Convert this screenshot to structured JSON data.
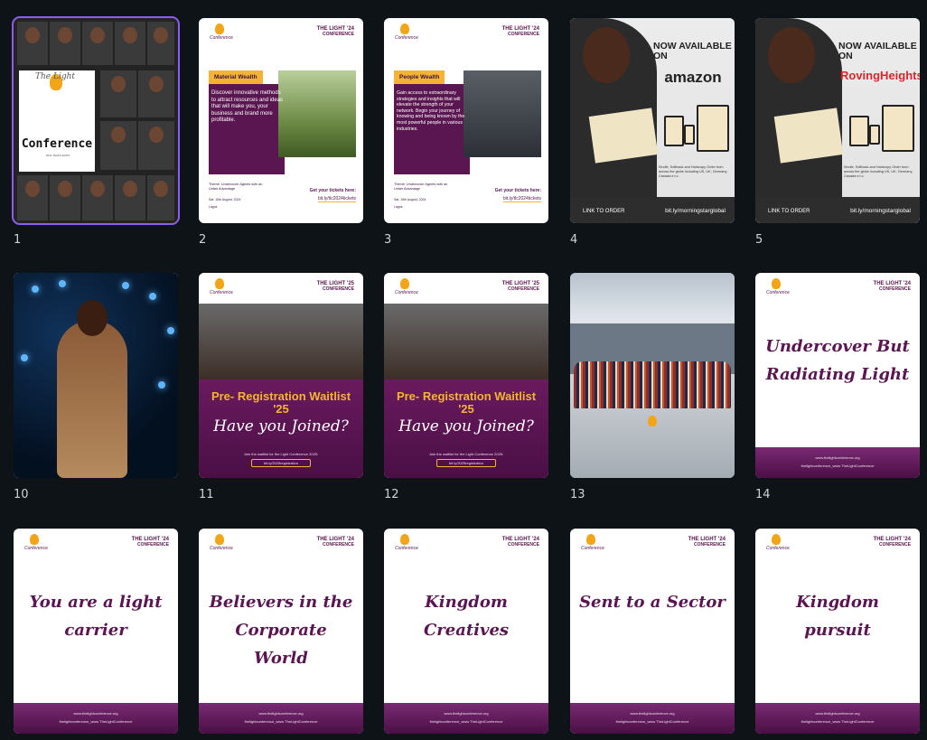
{
  "grid": {
    "selected_index": 0,
    "items": [
      {
        "number": "1",
        "kind": "collage",
        "title": "Conference",
        "pre": "The Light",
        "sub": "2024 TEAM LEADS"
      },
      {
        "number": "2",
        "kind": "wealth",
        "label": "Material Wealth",
        "body": "Discover innovative methods to attract resources and ideas that will make you, your business and brand more profitable.",
        "theme": "Theme: Undercover Agents with an Unfair Advantage",
        "date": "Sat. 10th August, 2024",
        "place": "Lagos",
        "get": "Get your tickets here:",
        "link": "bit.ly/tlc2024tickets"
      },
      {
        "number": "3",
        "kind": "wealth",
        "label": "People Wealth",
        "body": "Gain access to extraordinary strategies and insights that will elevate the strength of your network. Begin your journey of knowing and being known by the most powerful people in various industries.",
        "theme": "Theme: Undercover Agents with an Unfair Advantage",
        "date": "Sat. 10th August, 2024",
        "place": "Lagos",
        "get": "Get your tickets here:",
        "link": "bit.ly/tlc2024tickets"
      },
      {
        "number": "4",
        "kind": "book",
        "now": "NOW AVAILABLE ON",
        "store": "amazon",
        "store_color": "#222222",
        "desc": "Kindle, Softback and Hardcopy Order from across the globe including US, UK, Germany, Canada e.t.c.",
        "order": "LINK TO ORDER",
        "url": "bit.ly/morningstarglobal"
      },
      {
        "number": "5",
        "kind": "book",
        "now": "NOW AVAILABLE ON",
        "store": "RovingHeights",
        "store_color": "#d9262b",
        "desc": "Kindle, Softback and Hardcopy Order from across the globe including US, UK, Germany, Canada e.t.c.",
        "order": "LINK TO ORDER",
        "url": "bit.ly/morningstarglobal"
      },
      {
        "number": "10",
        "kind": "stage"
      },
      {
        "number": "11",
        "kind": "prereg",
        "brand": "THE LIGHT '25",
        "headline": "Pre- Registration Waitlist '25",
        "script": "Have you Joined?",
        "join": "Join the waitlist for the Light Conference 2025:",
        "link": "bit.ly/2025registration"
      },
      {
        "number": "12",
        "kind": "prereg",
        "brand": "THE LIGHT '25",
        "headline": "Pre- Registration Waitlist '25",
        "script": "Have you Joined?",
        "join": "Join the waitlist for the Light Conference 2025:",
        "link": "bit.ly/2025registration"
      },
      {
        "number": "13",
        "kind": "group"
      },
      {
        "number": "14",
        "kind": "quote",
        "brand": "THE LIGHT '24",
        "quote": "Undercover But Radiating Light"
      },
      {
        "number": "",
        "kind": "quote",
        "brand": "THE LIGHT '24",
        "quote": "You are a light carrier"
      },
      {
        "number": "",
        "kind": "quote",
        "brand": "THE LIGHT '24",
        "quote": "Believers in the Corporate World"
      },
      {
        "number": "",
        "kind": "quote",
        "brand": "THE LIGHT '24",
        "quote": "Kingdom Creatives"
      },
      {
        "number": "",
        "kind": "quote",
        "brand": "THE LIGHT '24",
        "quote": "Sent to a Sector"
      },
      {
        "number": "",
        "kind": "quote",
        "brand": "THE LIGHT '24",
        "quote": "Kingdom pursuit"
      }
    ]
  },
  "common": {
    "brand_sub": "CONFERENCE",
    "logo_text": "Conference",
    "footer_site": "www.thelightconference.org",
    "footer_social": "thelightconference_www   TheLightConference"
  },
  "colors": {
    "background": "#0e1318",
    "purple": "#5a1650",
    "gold": "#f5b335",
    "selection": "#8b5cf6"
  }
}
